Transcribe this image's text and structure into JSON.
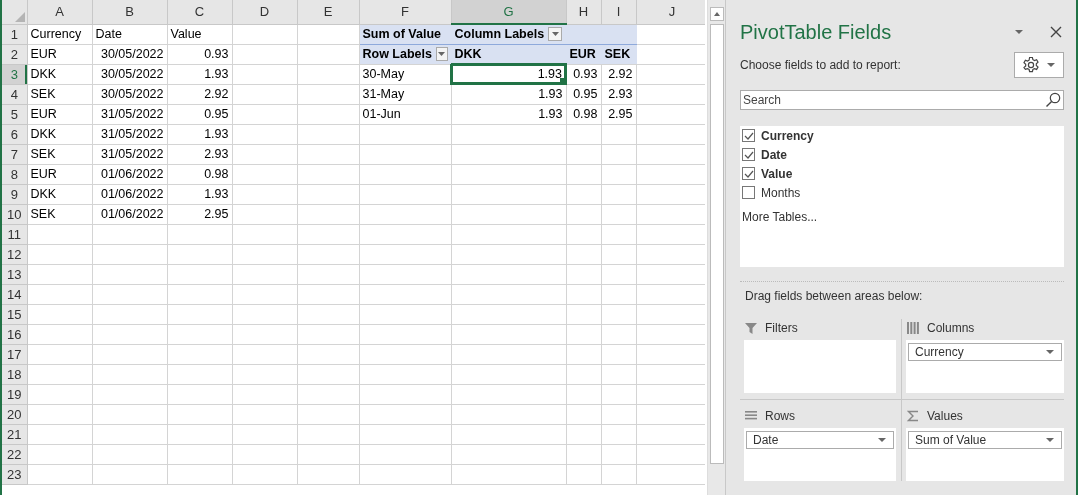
{
  "sheet": {
    "columns": [
      {
        "label": "A",
        "selected": false
      },
      {
        "label": "B",
        "selected": false
      },
      {
        "label": "C",
        "selected": false
      },
      {
        "label": "D",
        "selected": false
      },
      {
        "label": "E",
        "selected": false
      },
      {
        "label": "F",
        "selected": false
      },
      {
        "label": "G",
        "selected": true
      },
      {
        "label": "H",
        "selected": false
      },
      {
        "label": "I",
        "selected": false
      },
      {
        "label": "J",
        "selected": false
      }
    ],
    "rows": [
      {
        "header": "1",
        "selected": false,
        "cells": [
          {
            "kind": "text",
            "text": "Currency",
            "selected": false
          },
          {
            "kind": "text",
            "text": "Date",
            "selected": false
          },
          {
            "kind": "text",
            "text": "Value",
            "selected": false
          },
          {
            "kind": "empty",
            "selected": false
          },
          {
            "kind": "empty",
            "selected": false
          },
          {
            "kind": "pivot-header",
            "text": "Sum of Value",
            "filter": false,
            "selected": false
          },
          {
            "kind": "pivot-header",
            "text": "Column Labels",
            "filter": true,
            "selected": false
          },
          {
            "kind": "pivot-header",
            "filter": false,
            "selected": false
          },
          {
            "kind": "pivot-header",
            "filter": false,
            "selected": false
          }
        ]
      },
      {
        "header": "2",
        "selected": false,
        "cells": [
          {
            "kind": "text",
            "text": "EUR",
            "selected": false
          },
          {
            "kind": "number",
            "text": "30/05/2022",
            "selected": false
          },
          {
            "kind": "number",
            "text": "0.93",
            "selected": false
          },
          {
            "kind": "empty",
            "selected": false
          },
          {
            "kind": "empty",
            "selected": false
          },
          {
            "kind": "pivot-header",
            "text": "Row Labels",
            "filter": true,
            "selected": false
          },
          {
            "kind": "pivot-header",
            "text": "DKK",
            "filter": false,
            "selected": false
          },
          {
            "kind": "pivot-header",
            "text": "EUR",
            "filter": false,
            "selected": false
          },
          {
            "kind": "pivot-header",
            "text": "SEK",
            "filter": false,
            "selected": false
          }
        ]
      },
      {
        "header": "3",
        "selected": true,
        "cells": [
          {
            "kind": "text",
            "text": "DKK",
            "selected": false
          },
          {
            "kind": "number",
            "text": "30/05/2022",
            "selected": false
          },
          {
            "kind": "number",
            "text": "1.93",
            "selected": false
          },
          {
            "kind": "empty",
            "selected": false
          },
          {
            "kind": "empty",
            "selected": false
          },
          {
            "kind": "text",
            "text": "30-May",
            "selected": false
          },
          {
            "kind": "number",
            "text": "1.93",
            "selected": true
          },
          {
            "kind": "number",
            "text": "0.93",
            "selected": false
          },
          {
            "kind": "number",
            "text": "2.92",
            "selected": false
          }
        ]
      },
      {
        "header": "4",
        "selected": false,
        "cells": [
          {
            "kind": "text",
            "text": "SEK",
            "selected": false
          },
          {
            "kind": "number",
            "text": "30/05/2022",
            "selected": false
          },
          {
            "kind": "number",
            "text": "2.92",
            "selected": false
          },
          {
            "kind": "empty",
            "selected": false
          },
          {
            "kind": "empty",
            "selected": false
          },
          {
            "kind": "text",
            "text": "31-May",
            "selected": false
          },
          {
            "kind": "number",
            "text": "1.93",
            "selected": false
          },
          {
            "kind": "number",
            "text": "0.95",
            "selected": false
          },
          {
            "kind": "number",
            "text": "2.93",
            "selected": false
          }
        ]
      },
      {
        "header": "5",
        "selected": false,
        "cells": [
          {
            "kind": "text",
            "text": "EUR",
            "selected": false
          },
          {
            "kind": "number",
            "text": "31/05/2022",
            "selected": false
          },
          {
            "kind": "number",
            "text": "0.95",
            "selected": false
          },
          {
            "kind": "empty",
            "selected": false
          },
          {
            "kind": "empty",
            "selected": false
          },
          {
            "kind": "text",
            "text": "01-Jun",
            "selected": false
          },
          {
            "kind": "number",
            "text": "1.93",
            "selected": false
          },
          {
            "kind": "number",
            "text": "0.98",
            "selected": false
          },
          {
            "kind": "number",
            "text": "2.95",
            "selected": false
          }
        ]
      },
      {
        "header": "6",
        "selected": false,
        "cells": [
          {
            "kind": "text",
            "text": "DKK",
            "selected": false
          },
          {
            "kind": "number",
            "text": "31/05/2022",
            "selected": false
          },
          {
            "kind": "number",
            "text": "1.93",
            "selected": false
          }
        ]
      },
      {
        "header": "7",
        "selected": false,
        "cells": [
          {
            "kind": "text",
            "text": "SEK",
            "selected": false
          },
          {
            "kind": "number",
            "text": "31/05/2022",
            "selected": false
          },
          {
            "kind": "number",
            "text": "2.93",
            "selected": false
          }
        ]
      },
      {
        "header": "8",
        "selected": false,
        "cells": [
          {
            "kind": "text",
            "text": "EUR",
            "selected": false
          },
          {
            "kind": "number",
            "text": "01/06/2022",
            "selected": false
          },
          {
            "kind": "number",
            "text": "0.98",
            "selected": false
          }
        ]
      },
      {
        "header": "9",
        "selected": false,
        "cells": [
          {
            "kind": "text",
            "text": "DKK",
            "selected": false
          },
          {
            "kind": "number",
            "text": "01/06/2022",
            "selected": false
          },
          {
            "kind": "number",
            "text": "1.93",
            "selected": false
          }
        ]
      },
      {
        "header": "10",
        "selected": false,
        "cells": [
          {
            "kind": "text",
            "text": "SEK",
            "selected": false
          },
          {
            "kind": "number",
            "text": "01/06/2022",
            "selected": false
          },
          {
            "kind": "number",
            "text": "2.95",
            "selected": false
          }
        ]
      },
      {
        "header": "11",
        "selected": false
      },
      {
        "header": "12",
        "selected": false
      },
      {
        "header": "13",
        "selected": false
      },
      {
        "header": "14",
        "selected": false
      },
      {
        "header": "15",
        "selected": false
      },
      {
        "header": "16",
        "selected": false
      },
      {
        "header": "17",
        "selected": false
      },
      {
        "header": "18",
        "selected": false
      },
      {
        "header": "19",
        "selected": false
      },
      {
        "header": "20",
        "selected": false
      },
      {
        "header": "21",
        "selected": false
      },
      {
        "header": "22",
        "selected": false
      },
      {
        "header": "23",
        "selected": false
      }
    ]
  },
  "panel": {
    "title": "PivotTable Fields",
    "subtitle": "Choose fields to add to report:",
    "search": {
      "placeholder": "Search"
    },
    "fields": [
      {
        "label": "Currency",
        "checked": true
      },
      {
        "label": "Date",
        "checked": true
      },
      {
        "label": "Value",
        "checked": true
      },
      {
        "label": "Months",
        "checked": false
      }
    ],
    "more_tables": "More Tables...",
    "areas_hint": "Drag fields between areas below:",
    "areas": [
      {
        "kind": "filters",
        "label": "Filters"
      },
      {
        "kind": "columns",
        "label": "Columns",
        "items": [
          "Currency"
        ]
      },
      {
        "kind": "rows",
        "label": "Rows",
        "items": [
          "Date"
        ]
      },
      {
        "kind": "values",
        "label": "Values",
        "items": [
          "Sum of Value"
        ]
      }
    ]
  }
}
